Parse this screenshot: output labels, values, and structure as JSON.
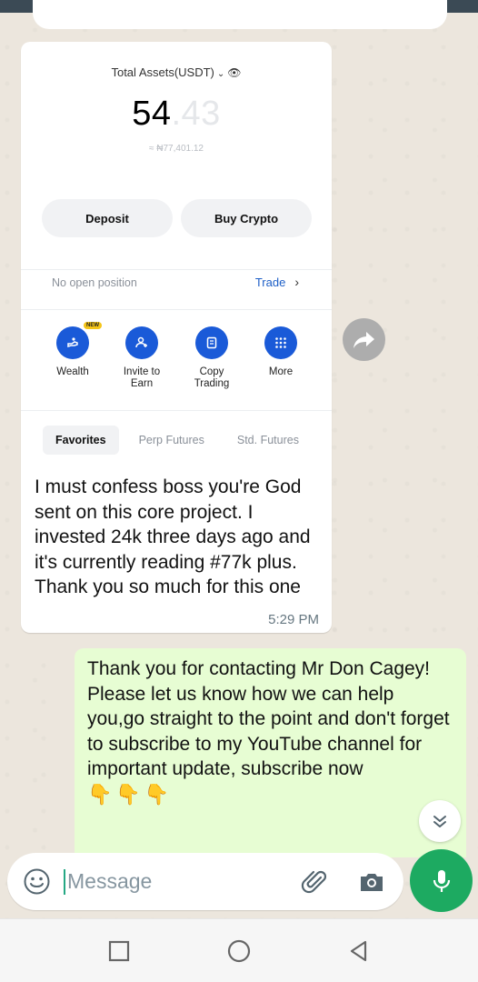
{
  "app": {
    "name": "WhatsApp chat"
  },
  "incoming": {
    "screenshot": {
      "assets_label": "Total Assets(USDT)",
      "balance_int": "54",
      "balance_dec": ".43",
      "fiat_equiv": "≈ ₦77,401.12",
      "deposit_label": "Deposit",
      "buy_label": "Buy Crypto",
      "no_position": "No open position",
      "trade_label": "Trade",
      "quick_actions": [
        {
          "label": "Wealth",
          "badge": "NEW",
          "icon": "wealth-icon"
        },
        {
          "label": "Invite to Earn",
          "icon": "invite-icon"
        },
        {
          "label": "Copy Trading",
          "icon": "copy-trading-icon"
        },
        {
          "label": "More",
          "icon": "grid-icon"
        }
      ],
      "tabs": [
        "Favorites",
        "Perp Futures",
        "Std. Futures"
      ]
    },
    "text": "I must confess boss you're God sent on this core project. I invested 24k three days ago and it's currently reading #77k plus. Thank you so much for this one",
    "time": "5:29 PM"
  },
  "outgoing": {
    "text": "Thank you for contacting Mr Don Cagey! Please let us know how we can help you,go straight to the point and don't forget to subscribe to my YouTube channel for important update, subscribe now",
    "emojis": "👇👇👇"
  },
  "composer": {
    "placeholder": "Message"
  },
  "colors": {
    "accent_green": "#1daa61",
    "outgoing_bubble": "#e7fdd3",
    "link_blue": "#1e5fc7"
  }
}
